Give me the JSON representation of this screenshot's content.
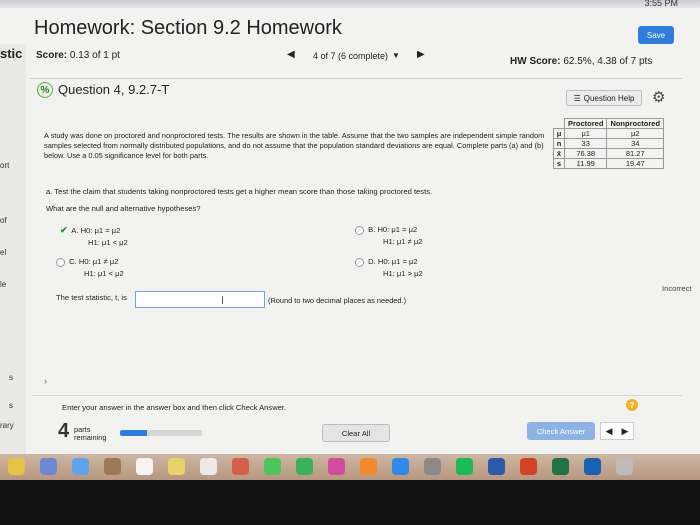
{
  "screen": {
    "clock": "3:55 PM"
  },
  "page": {
    "title": "Homework: Section 9.2 Homework",
    "save_label": "Save",
    "score_label": "Score:",
    "score_value": "0.13 of 1 pt",
    "progress": "4 of 7 (6 complete)",
    "hw_score_label": "HW Score:",
    "hw_score_value": "62.5%, 4.38 of 7 pts",
    "question_title": "Question 4, 9.2.7-T",
    "question_help_label": "Question Help"
  },
  "left_fragments": [
    "stic",
    "ort",
    "of",
    "el",
    "le",
    "s",
    "s",
    "rary"
  ],
  "question": {
    "intro": "A study was done on proctored and nonproctored tests. The results are shown in the table. Assume that the two samples are independent simple random samples selected from normally distributed populations, and do not assume that the population standard deviations are equal. Complete parts (a) and (b) below. Use a 0.05 significance level for both parts.",
    "part_a": "a. Test the claim that students taking nonproctored tests get a higher mean score than those taking proctored tests.",
    "prompt": "What are the null and alternative hypotheses?",
    "stat_label": "The test statistic, t, is",
    "stat_value": "",
    "stat_hint": "(Round to two decimal places as needed.)"
  },
  "table": {
    "headers": [
      "Proctored",
      "Nonproctored"
    ],
    "rows": [
      {
        "label": "μ",
        "values": [
          "μ1",
          "μ2"
        ]
      },
      {
        "label": "n",
        "values": [
          "33",
          "34"
        ]
      },
      {
        "label": "x̄",
        "values": [
          "76.38",
          "81.27"
        ]
      },
      {
        "label": "s",
        "values": [
          "11.99",
          "19.47"
        ]
      }
    ]
  },
  "options": [
    {
      "letter": "A.",
      "h0": "H0: μ1 = μ2",
      "h1": "H1: μ1 < μ2",
      "selected": true
    },
    {
      "letter": "B.",
      "h0": "H0: μ1 = μ2",
      "h1": "H1: μ1 ≠ μ2",
      "selected": false
    },
    {
      "letter": "C.",
      "h0": "H0: μ1 ≠ μ2",
      "h1": "H1: μ1 < μ2",
      "selected": false
    },
    {
      "letter": "D.",
      "h0": "H0: μ1 = μ2",
      "h1": "H1: μ1 > μ2",
      "selected": false
    }
  ],
  "status": {
    "incorrect_label": "Incorrect"
  },
  "footer": {
    "instruction": "Enter your answer in the answer box and then click Check Answer.",
    "parts_count": "4",
    "parts_label_1": "parts",
    "parts_label_2": "remaining",
    "progress_fraction": 0.33,
    "clear_label": "Clear All",
    "check_label": "Check Answer"
  },
  "colors": {
    "accent": "#2f7ddc",
    "check_green": "#2e8b2e",
    "help_orange": "#f2b12c"
  },
  "dock": [
    {
      "name": "chrome-icon",
      "color": "#e7c244"
    },
    {
      "name": "launchpad-icon",
      "color": "#6c8ad1"
    },
    {
      "name": "finder-icon",
      "color": "#5fa4e8"
    },
    {
      "name": "contacts-icon",
      "color": "#9c7a55"
    },
    {
      "name": "calendar-icon",
      "color": "#f4f4f4"
    },
    {
      "name": "notes-icon",
      "color": "#e8d26a"
    },
    {
      "name": "reminders-icon",
      "color": "#eaeaea"
    },
    {
      "name": "photos-icon",
      "color": "#d4604a"
    },
    {
      "name": "messages-icon",
      "color": "#4fc45c"
    },
    {
      "name": "facetime-icon",
      "color": "#3ab25a"
    },
    {
      "name": "itunes-icon",
      "color": "#d04ca0"
    },
    {
      "name": "ibooks-icon",
      "color": "#f08a2c"
    },
    {
      "name": "appstore-icon",
      "color": "#2d8ae6"
    },
    {
      "name": "preferences-icon",
      "color": "#8a8a8a"
    },
    {
      "name": "spotify-icon",
      "color": "#1db954"
    },
    {
      "name": "word-icon",
      "color": "#2b5aa7"
    },
    {
      "name": "powerpoint-icon",
      "color": "#d04423"
    },
    {
      "name": "excel-icon",
      "color": "#1f7244"
    },
    {
      "name": "video-icon",
      "color": "#1b5fb0"
    },
    {
      "name": "trash-icon",
      "color": "#bbbbbb"
    }
  ]
}
